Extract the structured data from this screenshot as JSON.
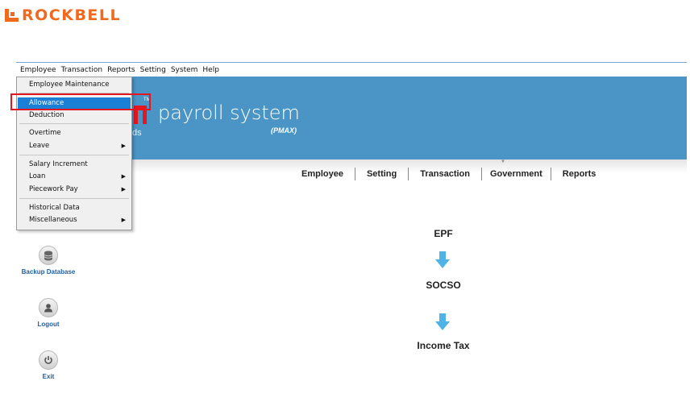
{
  "brand": {
    "name": "ROCKBELL"
  },
  "menubar": {
    "items": [
      "Employee",
      "Transaction",
      "Reports",
      "Setting",
      "System",
      "Help"
    ]
  },
  "banner": {
    "title": "payroll system",
    "subtitle": "(PMAX)",
    "tm": "TM",
    "tagline_fragment": "ds"
  },
  "nav": {
    "items": [
      "Employee",
      "Setting",
      "Transaction",
      "Government",
      "Reports"
    ]
  },
  "sidebar": {
    "backup": "Backup Database",
    "logout": "Logout",
    "exit": "Exit"
  },
  "flow": {
    "steps": [
      "EPF",
      "SOCSO",
      "Income Tax"
    ]
  },
  "employee_menu": {
    "items": [
      {
        "label": "Employee Maintenance",
        "submenu": false
      },
      {
        "label": "Allowance",
        "submenu": false,
        "selected": true
      },
      {
        "label": "Deduction",
        "submenu": false
      },
      {
        "label": "Overtime",
        "submenu": false
      },
      {
        "label": "Leave",
        "submenu": true
      },
      {
        "label": "Salary Increment",
        "submenu": false
      },
      {
        "label": "Loan",
        "submenu": true
      },
      {
        "label": "Piecework Pay",
        "submenu": true
      },
      {
        "label": "Historical Data",
        "submenu": false
      },
      {
        "label": "Miscellaneous",
        "submenu": true
      }
    ]
  },
  "colors": {
    "brand": "#f0691e",
    "banner": "#4a95c6",
    "highlight": "#1c7fd6",
    "callout": "#e3171d",
    "arrow": "#4fb3e8"
  }
}
